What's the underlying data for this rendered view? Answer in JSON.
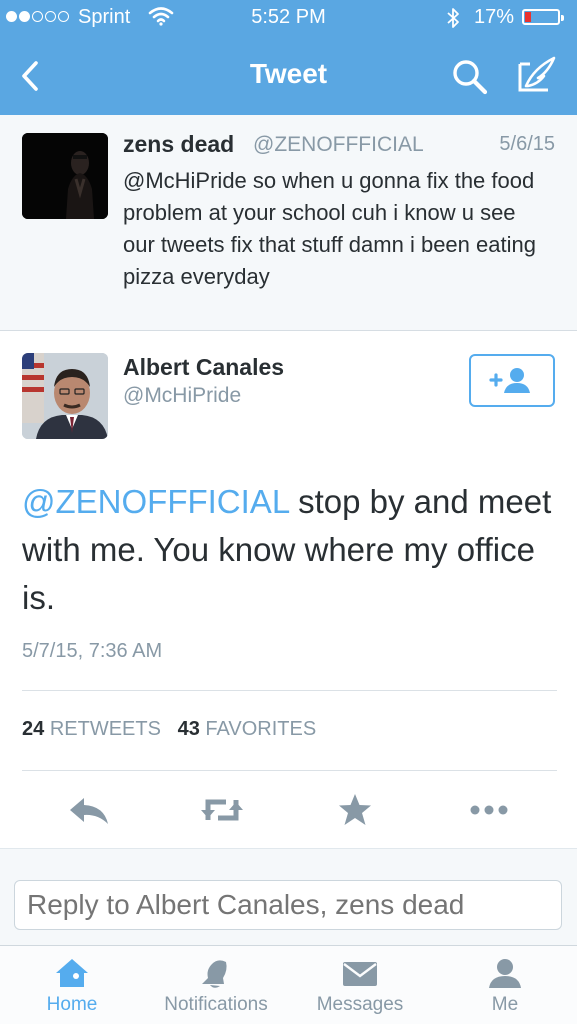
{
  "status_bar": {
    "carrier": "Sprint",
    "time": "5:52 PM",
    "battery_percent": "17%",
    "signal_bars_filled": 2,
    "signal_bars_total": 5
  },
  "nav": {
    "title": "Tweet",
    "back_icon": "chevron-left-icon",
    "search_icon": "search-icon",
    "compose_icon": "compose-icon"
  },
  "parent_tweet": {
    "name": "zens dead",
    "handle": "@ZENOFFFICIAL",
    "date": "5/6/15",
    "text": "@McHiPride so when u gonna fix the food problem at your school cuh i know u see our tweets fix that stuff damn i been eating pizza everyday"
  },
  "main_tweet": {
    "name": "Albert Canales",
    "handle": "@McHiPride",
    "mention": "@ZENOFFFICIAL",
    "text": " stop by and meet with me.  You know where my office is.",
    "timestamp": "5/7/15, 7:36 AM",
    "retweets_count": "24",
    "retweets_label": "RETWEETS",
    "favorites_count": "43",
    "favorites_label": "FAVORITES"
  },
  "reply": {
    "placeholder": "Reply to Albert Canales, zens dead"
  },
  "tabs": [
    {
      "label": "Home",
      "icon": "home-icon",
      "active": true
    },
    {
      "label": "Notifications",
      "icon": "bell-icon",
      "active": false
    },
    {
      "label": "Messages",
      "icon": "envelope-icon",
      "active": false
    },
    {
      "label": "Me",
      "icon": "person-icon",
      "active": false
    }
  ],
  "colors": {
    "brand": "#55acee",
    "nav_bar": "#5aa7e2",
    "text": "#292f33",
    "muted": "#8899a6"
  }
}
